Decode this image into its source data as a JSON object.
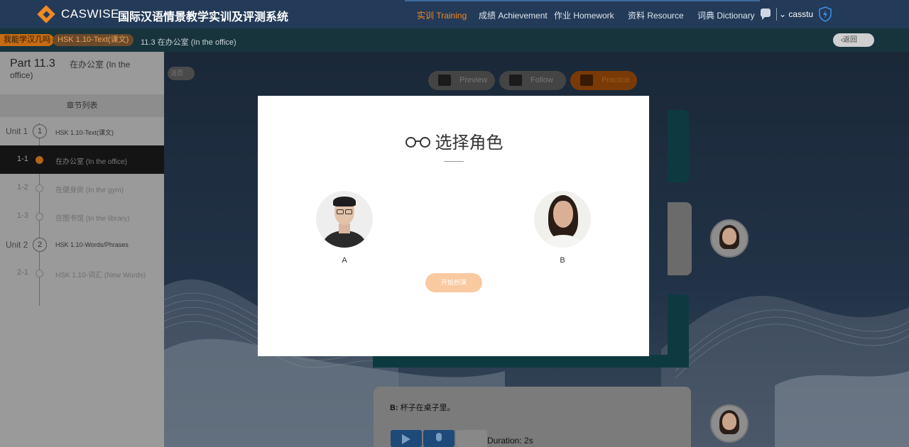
{
  "header": {
    "logo_text": "CASWISE",
    "system_title": "国际汉语情景教学实训及评测系统",
    "nav": [
      {
        "label": "实训 Training",
        "active": true
      },
      {
        "label": "成绩 Achievement",
        "active": false
      },
      {
        "label": "作业 Homework",
        "active": false
      },
      {
        "label": "资料 Resource",
        "active": false
      },
      {
        "label": "词典 Dictionary",
        "active": false
      }
    ],
    "username": "casstu",
    "accent_color": "#f08a24"
  },
  "breadcrumb": {
    "items": [
      "我能学汉几吗",
      "HSK 1.10-Text(课文)",
      "11.3 在办公室 (In the office)"
    ],
    "back_label": "返回"
  },
  "sidebar": {
    "part_title": "Part 11.3",
    "part_subtitle_line1": "在办公室 (In the",
    "part_subtitle_line2": "office)",
    "chapter_list_label": "章节列表",
    "rows": [
      {
        "num": "Unit 1",
        "circle": "1",
        "label": "HSK 1.10-Text(课文)",
        "type": "unit"
      },
      {
        "num": "1-1",
        "label": "在办公室 (In the office)",
        "type": "lesson",
        "active": true
      },
      {
        "num": "1-2",
        "label": "在健身房 (In the gym)",
        "type": "lesson"
      },
      {
        "num": "1-3",
        "label": "在图书馆 (In the library)",
        "type": "lesson"
      },
      {
        "num": "Unit 2",
        "circle": "2",
        "label": "HSK 1.10-Words/Phrases",
        "type": "unit"
      },
      {
        "num": "2-1",
        "label": "HSK 1.10-词汇 (New Words)",
        "type": "lesson"
      }
    ]
  },
  "main": {
    "small_pill": "活页",
    "modes": [
      {
        "label": "Preview",
        "active": false
      },
      {
        "label": "Follow",
        "active": false
      },
      {
        "label": "Practice",
        "active": true
      }
    ],
    "dialog_speaker": "B:",
    "dialog_text": "杯子在桌子里。",
    "duration_label": "Duration:",
    "duration_value": "2s"
  },
  "modal": {
    "title": "选择角色",
    "roles": [
      {
        "label": "A"
      },
      {
        "label": "B"
      }
    ],
    "start_button": "开始扮演"
  }
}
